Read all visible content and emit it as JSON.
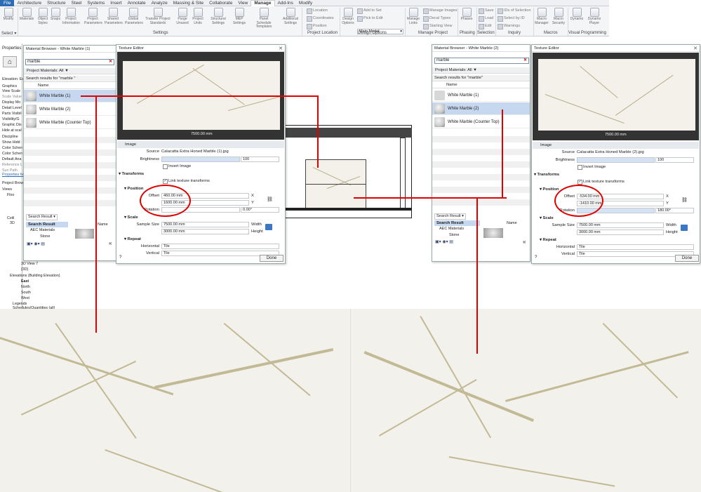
{
  "ribbon": {
    "tabs": [
      {
        "label": "File"
      },
      {
        "label": "Architecture"
      },
      {
        "label": "Structure"
      },
      {
        "label": "Steel"
      },
      {
        "label": "Systems"
      },
      {
        "label": "Insert"
      },
      {
        "label": "Annotate"
      },
      {
        "label": "Analyze"
      },
      {
        "label": "Massing & Site"
      },
      {
        "label": "Collaborate"
      },
      {
        "label": "View"
      },
      {
        "label": "Manage"
      },
      {
        "label": "Add-Ins"
      },
      {
        "label": "Modify"
      }
    ],
    "buttons": [
      {
        "label": "Modify"
      },
      {
        "label": "Materials"
      },
      {
        "label": "Object Styles"
      },
      {
        "label": "Snaps"
      },
      {
        "label": "Project Information"
      },
      {
        "label": "Project Parameters"
      },
      {
        "label": "Shared Parameters"
      },
      {
        "label": "Global Parameters"
      },
      {
        "label": "Transfer Project Standards"
      },
      {
        "label": "Purge Unused"
      },
      {
        "label": "Project Units"
      },
      {
        "label": "Structural Settings"
      },
      {
        "label": "MEP Settings"
      },
      {
        "label": "Panel Schedule Templates"
      },
      {
        "label": "Additional Settings"
      },
      {
        "label": "Design Options"
      },
      {
        "label": "Manage Links"
      },
      {
        "label": "Phases"
      },
      {
        "label": "Macro Manager"
      },
      {
        "label": "Macro Security"
      },
      {
        "label": "Dynamo"
      },
      {
        "label": "Dynamo Player"
      }
    ],
    "small_items": {
      "location": "Location",
      "coordinates": "Coordinates",
      "position": "Position",
      "add_to_set": "Add to Set",
      "pick_to_edit": "Pick to Edit",
      "main_model": "Main Model",
      "manage_images": "Manage Images",
      "decal_types": "Decal Types",
      "starting_view": "Starting View",
      "save": "Save",
      "load": "Load",
      "edit": "Edit",
      "ids_of_selection": "IDs of Selection",
      "select_by_id": "Select by ID",
      "warnings": "Warnings"
    },
    "groups": {
      "select": "Select",
      "settings": "Settings",
      "project_location": "Project Location",
      "design_options": "Design Options",
      "manage_project": "Manage Project",
      "phasing": "Phasing",
      "selection": "Selection",
      "inquiry": "Inquiry",
      "macros": "Macros",
      "visual_programming": "Visual Programming"
    }
  },
  "left_panel": {
    "title": "Properties",
    "lines": [
      "Elevation: Ea",
      "Graphics",
      "View Scale",
      "Scale Value",
      "Display Mo",
      "Detail Level",
      "Parts Visibil",
      "Visibility/G",
      "Graphic Dis",
      "Hide at scal",
      "Discipline",
      "Show Hidd",
      "Color Schen",
      "Color Schen",
      "Default Ana",
      "Reference L",
      "Sun Path"
    ],
    "properties_help": "Properties he",
    "project_browser": "Project Brow",
    "tree": [
      "Views",
      "Floo",
      "Ceili",
      "3D",
      "3D View 7",
      "{3D}",
      "Elevations (Building Elevation)",
      "East",
      "North",
      "South",
      "West",
      "Legends",
      "Schedules/Quantities (all)"
    ]
  },
  "mb1": {
    "title": "Material Browser - White Marble (1)",
    "search": "marble",
    "project_materials": "Project Materials: All",
    "results_label": "Search results for \"marble \"",
    "name_header": "Name",
    "items": [
      "White Marble (1)",
      "White Marble (2)",
      "White Marble (Counter Top)"
    ],
    "search_result_dropdown": "Search Result",
    "tree_search_result": "Search Result",
    "tree_aec": "AEC Materials",
    "tree_stone": "Stone",
    "name_col": "Name"
  },
  "mb2": {
    "title": "Material Browser - White Marble (2)",
    "search": "marble",
    "project_materials": "Project Materials: All",
    "results_label": "Search results for \"marble\"",
    "name_header": "Name",
    "items": [
      "White Marble (1)",
      "White Marble (2)",
      "White Marble (Counter Top)"
    ],
    "search_result_dropdown": "Search Result",
    "tree_search_result": "Search Result",
    "tree_aec": "AEC Materials",
    "tree_stone": "Stone",
    "name_col": "Name"
  },
  "te1": {
    "title": "Texture Editor",
    "dim_h": "7500.00 mm",
    "dim_v": "3000.00 mm",
    "image_section": "Image",
    "source_label": "Source",
    "source_value": "Calacatta Extra Honed Marble (1).jpg",
    "brightness_label": "Brightness",
    "brightness_value": "100",
    "invert_label": "Invert Image",
    "transforms": "Transforms",
    "link_label": "Link texture transforms",
    "position": "Position",
    "offset_label": "Offset",
    "offset_x": "460.00 mm",
    "offset_y": "1600.00 mm",
    "x": "X",
    "y": "Y",
    "rotation_label": "Rotation",
    "rotation_value": "0.00°",
    "scale": "Scale",
    "sample_size_label": "Sample Size",
    "width_value": "7500.00 mm",
    "height_value": "3000.00 mm",
    "width_label": "Width",
    "height_label": "Height",
    "repeat": "Repeat",
    "horizontal_label": "Horizontal",
    "horizontal_value": "Tile",
    "vertical_label": "Vertical",
    "vertical_value": "Tile",
    "done": "Done"
  },
  "te2": {
    "title": "Texture Editor",
    "dim_h": "7500.00 mm",
    "dim_v": "3000.00 mm",
    "image_section": "Image",
    "source_label": "Source",
    "source_value": "Calacatta Extra Honed Marble (2).jpg",
    "brightness_label": "Brightness",
    "brightness_value": "100",
    "invert_label": "Invert Image",
    "transforms": "Transforms",
    "link_label": "Link texture transforms",
    "position": "Position",
    "offset_label": "Offset",
    "offset_x": "-534.00 mm",
    "offset_y": "-1410.00 mm",
    "x": "X",
    "y": "Y",
    "rotation_label": "Rotation",
    "rotation_value": "180.00°",
    "scale": "Scale",
    "sample_size_label": "Sample Size",
    "width_value": "7500.00 mm",
    "height_value": "3000.00 mm",
    "width_label": "Width",
    "height_label": "Height",
    "repeat": "Repeat",
    "horizontal_label": "Horizontal",
    "horizontal_value": "Tile",
    "vertical_label": "Vertical",
    "vertical_value": "Tile",
    "done": "Done"
  },
  "colors": {
    "accent": "#2b6cb5",
    "annotation": "#e00000",
    "selection": "#c6d8ef"
  }
}
